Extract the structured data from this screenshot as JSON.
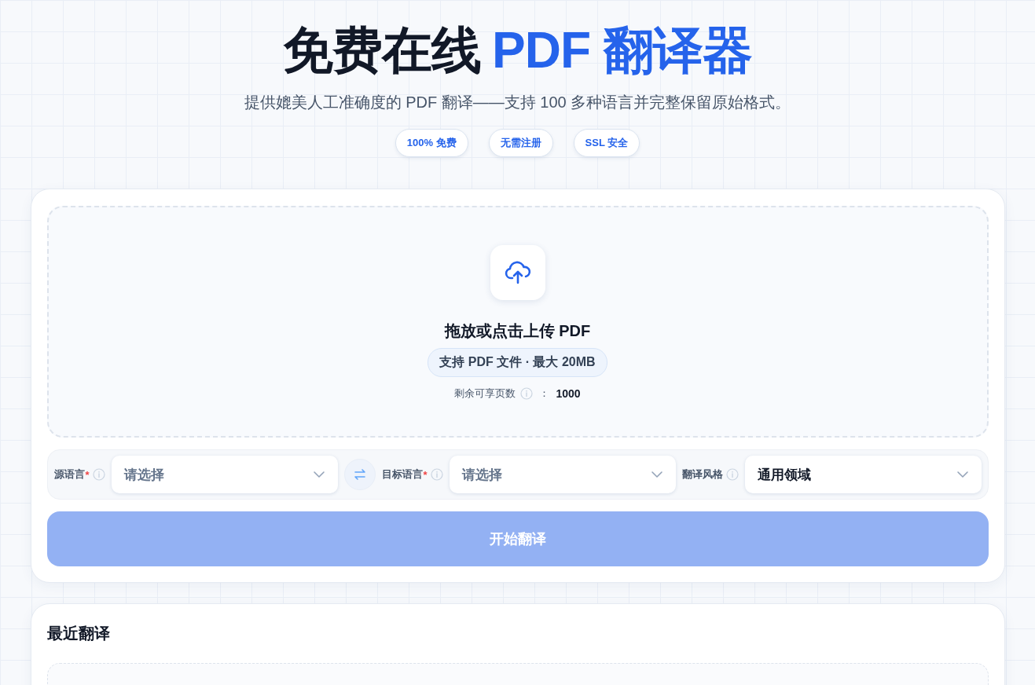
{
  "hero": {
    "title": "免费在线",
    "title_accent": "PDF 翻译器",
    "subtitle": "提供媲美人工准确度的 PDF 翻译——支持 100 多种语言并完整保留原始格式。",
    "badges": [
      "100% 免费",
      "无需注册",
      "SSL 安全"
    ]
  },
  "upload": {
    "title": "拖放或点击上传 PDF",
    "hint": "支持 PDF 文件 · 最大 20MB",
    "quota_label": "剩余可享页数",
    "quota_sep": "：",
    "quota_value": "1000"
  },
  "selects": [
    {
      "kind": "select",
      "label": "源语言",
      "required_mark": "*",
      "placeholder": "请选择"
    },
    {
      "kind": "swap"
    },
    {
      "kind": "select",
      "label": "目标语言",
      "required_mark": "*",
      "placeholder": "请选择"
    },
    {
      "kind": "select",
      "label": "翻译风格",
      "value": "通用领域"
    }
  ],
  "start_button": {
    "label": "开始翻译",
    "disabled": true
  },
  "recent": {
    "title": "最近翻译"
  }
}
